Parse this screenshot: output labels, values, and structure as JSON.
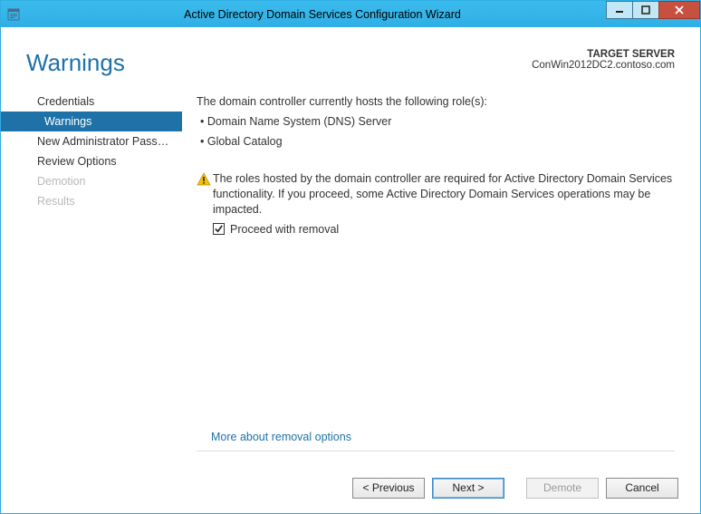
{
  "window": {
    "title": "Active Directory Domain Services Configuration Wizard"
  },
  "header": {
    "pageTitle": "Warnings",
    "targetLabel": "TARGET SERVER",
    "targetServer": "ConWin2012DC2.contoso.com"
  },
  "sidebar": {
    "items": [
      {
        "label": "Credentials",
        "state": "normal"
      },
      {
        "label": "Warnings",
        "state": "active"
      },
      {
        "label": "New Administrator Passw...",
        "state": "normal"
      },
      {
        "label": "Review Options",
        "state": "normal"
      },
      {
        "label": "Demotion",
        "state": "disabled"
      },
      {
        "label": "Results",
        "state": "disabled"
      }
    ]
  },
  "main": {
    "intro": "The domain controller currently hosts the following role(s):",
    "roles": [
      "Domain Name System (DNS) Server",
      "Global Catalog"
    ],
    "warning": "The roles hosted by the domain controller are required for Active Directory Domain Services functionality. If you proceed, some Active Directory Domain Services operations may be impacted.",
    "proceedLabel": "Proceed with removal",
    "proceedChecked": true,
    "moreLink": "More about removal options"
  },
  "footer": {
    "previous": "< Previous",
    "next": "Next >",
    "demote": "Demote",
    "cancel": "Cancel"
  }
}
